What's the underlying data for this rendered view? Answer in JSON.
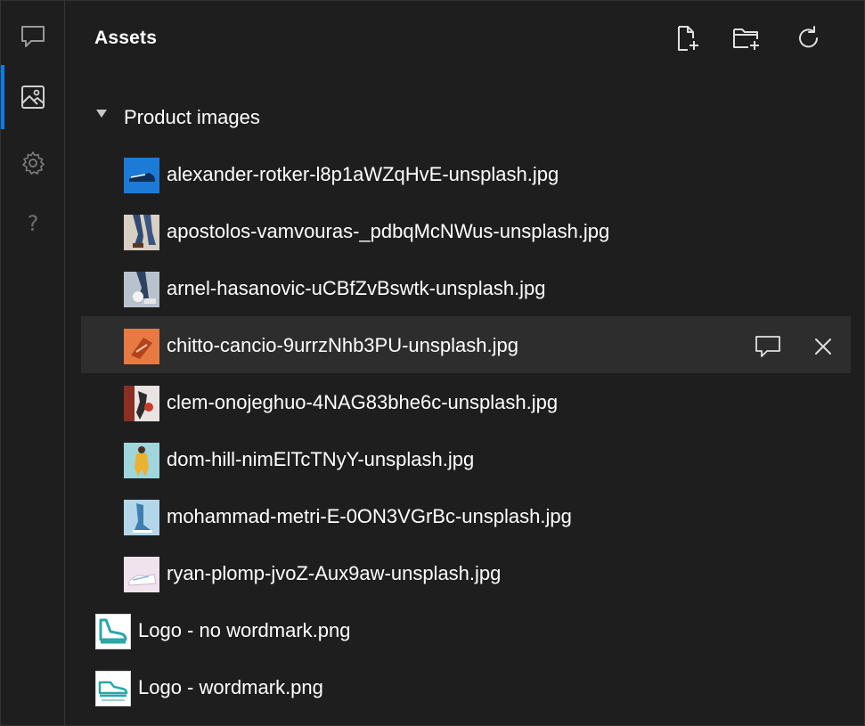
{
  "panel": {
    "title": "Assets"
  },
  "activity_bar": {
    "items": [
      {
        "icon": "comment-icon",
        "active": false
      },
      {
        "icon": "image-icon",
        "active": true
      },
      {
        "icon": "gear-icon",
        "active": false
      },
      {
        "icon": "help-icon",
        "active": false,
        "glyph": "?"
      }
    ],
    "accent_color": "#0a7ee8"
  },
  "header_actions": [
    {
      "icon": "new-file-icon"
    },
    {
      "icon": "new-folder-icon"
    },
    {
      "icon": "refresh-icon"
    }
  ],
  "tree": {
    "folder": {
      "label": "Product images",
      "expanded": true,
      "files": [
        {
          "name": "alexander-rotker-l8p1aWZqHvE-unsplash.jpg",
          "thumb_color": "#1d7bd8"
        },
        {
          "name": "apostolos-vamvouras-_pdbqMcNWus-unsplash.jpg",
          "thumb_color": "#b9b0a3"
        },
        {
          "name": "arnel-hasanovic-uCBfZvBswtk-unsplash.jpg",
          "thumb_color": "#9aa7b2"
        },
        {
          "name": "chitto-cancio-9urrzNhb3PU-unsplash.jpg",
          "thumb_color": "#e2703d",
          "selected": true
        },
        {
          "name": "clem-onojeghuo-4NAG83bhe6c-unsplash.jpg",
          "thumb_color": "#8a3a2e"
        },
        {
          "name": "dom-hill-nimElTcTNyY-unsplash.jpg",
          "thumb_color": "#e6b23a"
        },
        {
          "name": "mohammad-metri-E-0ON3VGrBc-unsplash.jpg",
          "thumb_color": "#a8cde3"
        },
        {
          "name": "ryan-plomp-jvoZ-Aux9aw-unsplash.jpg",
          "thumb_color": "#e8d6e6"
        }
      ]
    },
    "root_files": [
      {
        "name": "Logo - no wordmark.png",
        "thumb_color": "#ffffff",
        "logo_color": "#2aa7a7"
      },
      {
        "name": "Logo - wordmark.png",
        "thumb_color": "#ffffff",
        "logo_color": "#2aa7a7"
      }
    ]
  },
  "selected_row_actions": [
    {
      "icon": "comment-icon"
    },
    {
      "icon": "close-icon"
    }
  ]
}
